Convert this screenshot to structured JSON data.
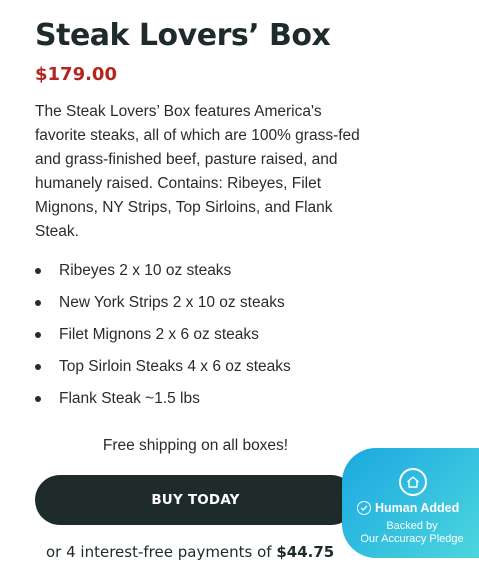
{
  "product": {
    "title": "Steak Lovers’ Box",
    "price": "$179.00",
    "description": "The Steak Lovers’ Box features America's favorite steaks, all of which are 100% grass-fed and grass-finished beef, pasture raised, and humanely raised. Contains: Ribeyes, Filet Mignons, NY Strips, Top Sirloins, and Flank Steak.",
    "items": [
      "Ribeyes 2 x 10 oz steaks",
      "New York Strips 2 x 10 oz steaks",
      "Filet Mignons 2 x 6 oz steaks",
      "Top Sirloin Steaks 4 x 6 oz steaks",
      "Flank Steak ~1.5 lbs"
    ],
    "shipping_note": "Free shipping on all boxes!",
    "buy_label": "BUY TODAY",
    "installments_prefix": "or 4 interest-free payments of ",
    "installments_amount": "$44.75"
  },
  "badge": {
    "title": "Human Added",
    "line1": "Backed by",
    "line2": "Our Accuracy Pledge",
    "logo_icon": "house-heart-icon",
    "check_icon": "check-circle-icon"
  },
  "colors": {
    "title": "#1f2a2b",
    "price": "#b3261e",
    "button_bg": "#1f2a2b",
    "badge_gradient_start": "#1aa8e0",
    "badge_gradient_end": "#4fd8de"
  }
}
